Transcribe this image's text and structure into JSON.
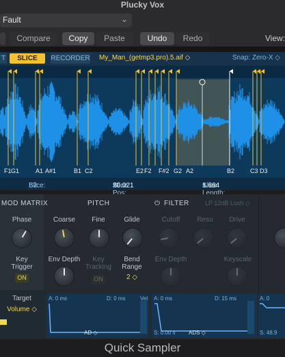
{
  "window": {
    "title": "Plucky Vox",
    "preset": "Fault",
    "footer": "Quick Sampler"
  },
  "toolbar": {
    "compare": "Compare",
    "copy": "Copy",
    "paste": "Paste",
    "undo": "Undo",
    "redo": "Redo",
    "view": "View:"
  },
  "sampler": {
    "modes": [
      "T",
      "SLICE",
      "RECORDER"
    ],
    "filename": "My_Man_(getmp3.pro).5.aif ◇",
    "snap_label": "Snap:",
    "snap_value": "Zero-X ◇",
    "note_labels": [
      "F1",
      "G1",
      "A1",
      "A#1",
      "B1",
      "C2",
      "E2",
      "F2",
      "F#2",
      "G2",
      "A2",
      "B2",
      "C3",
      "D3"
    ],
    "slice_label": "Slice:",
    "slice_value": "B2",
    "slice_pos_label": "Slice Pos:",
    "slice_pos_value": "20.021",
    "slice_pos_unit": "s",
    "slice_len_label": "Slice Length:",
    "slice_len_value": "1.664",
    "slice_len_unit": "s"
  },
  "modmatrix": {
    "title": "MOD MATRIX",
    "phase": "Phase",
    "key_trigger": "Key\nTrigger",
    "key_trigger_btn": "ON",
    "target": "Target",
    "target_value": "Volume ◇"
  },
  "pitch": {
    "title": "PITCH",
    "coarse": "Coarse",
    "fine": "Fine",
    "glide": "Glide",
    "env_depth": "Env Depth",
    "key_tracking": "Key\nTracking",
    "key_tracking_btn": "ON",
    "bend_range": "Bend\nRange",
    "bend_value": "2 ◇"
  },
  "filter": {
    "title": "FILTER",
    "type": "LP 12dB Lush ◇",
    "cutoff": "Cutoff",
    "reso": "Reso",
    "drive": "Drive",
    "env_depth": "Env Depth",
    "keyscale": "Keyscale"
  },
  "envelopes": {
    "pitch_a": "A: 0 ms",
    "pitch_d": "D: 0 ms",
    "pitch_mode": "AD ◇",
    "filter_a": "A: 0 ms",
    "filter_d": "D: 15 ms",
    "filter_s": "S: 0.00 s",
    "filter_mode": "ADS ◇",
    "amp_a": "A: 0",
    "amp_s": "S: 48.9",
    "vel": "Vel"
  },
  "colors": {
    "accent_yellow": "#ffd84a",
    "wave_blue": "#1e90e6",
    "wave_bg": "#0d3a5a"
  }
}
